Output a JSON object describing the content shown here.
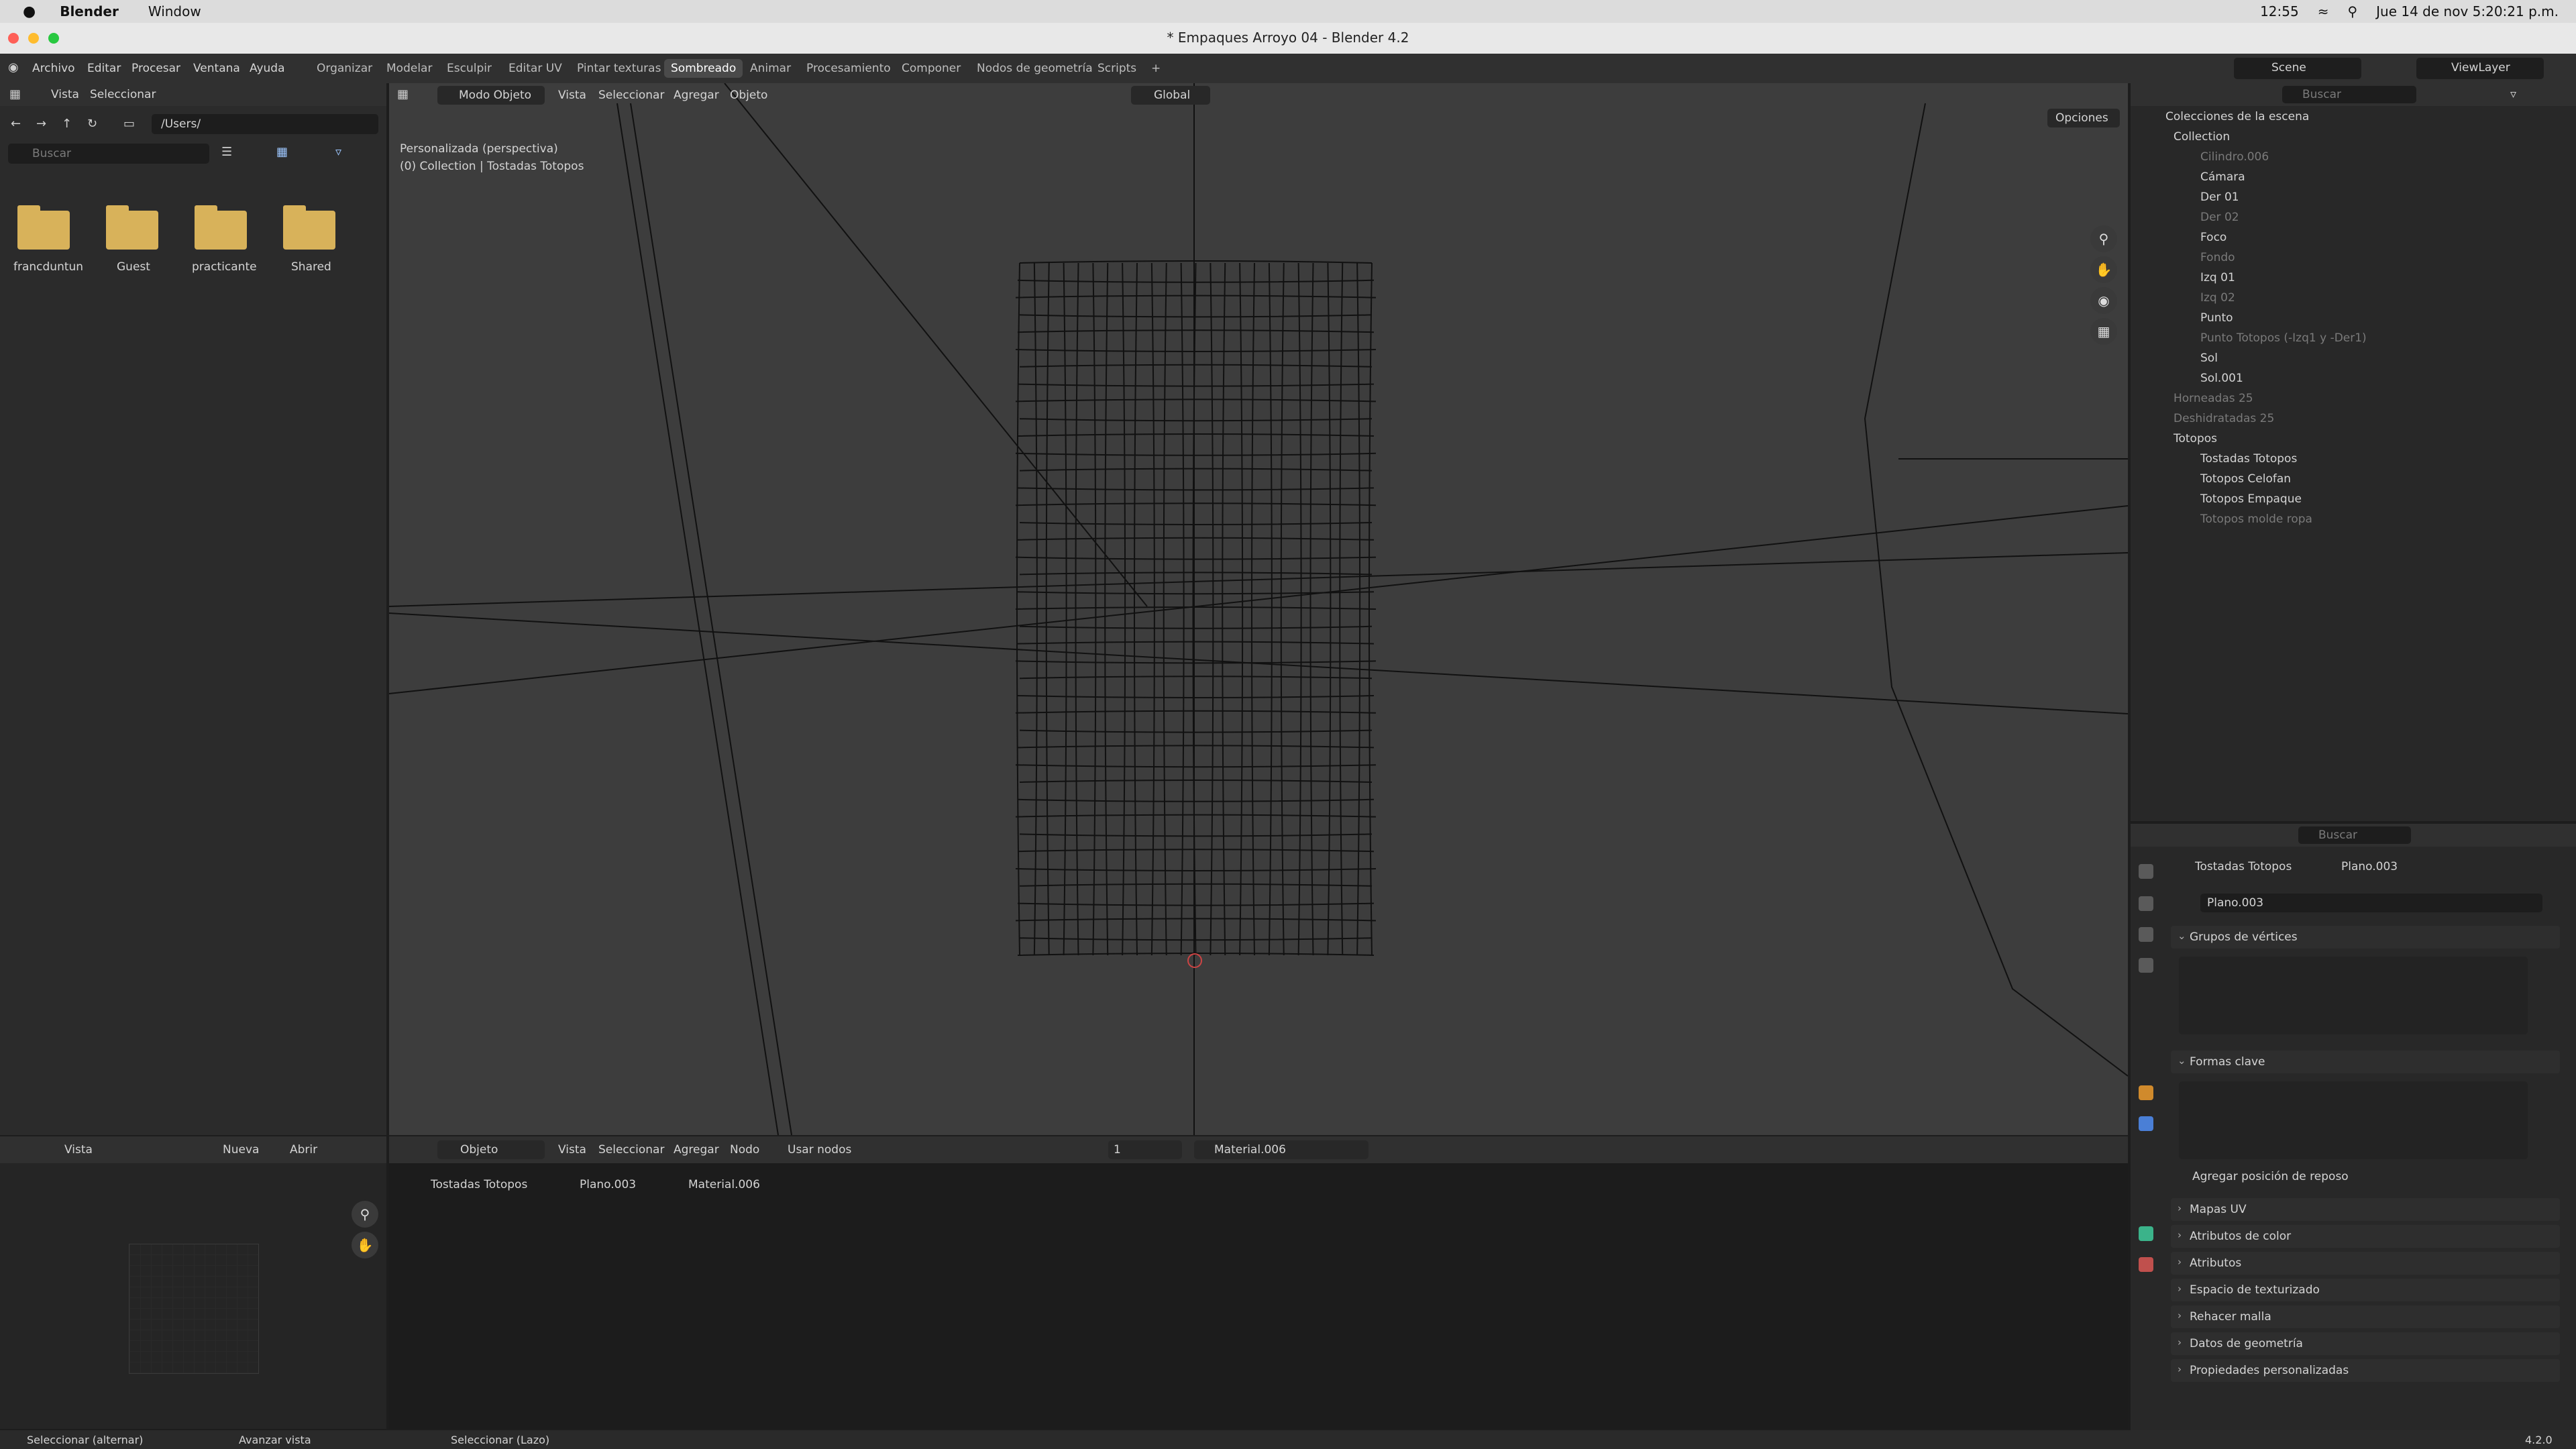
{
  "mac_menu": {
    "apple": "",
    "app": "Blender",
    "window": "Window",
    "time": "12:55",
    "date": "Jue 14 de nov  5:20:21 p.m."
  },
  "window": {
    "title": "* Empaques Arroyo 04 - Blender 4.2"
  },
  "topbar": {
    "menus": [
      "Archivo",
      "Editar",
      "Procesar",
      "Ventana",
      "Ayuda"
    ],
    "workspaces": [
      "Organizar",
      "Modelar",
      "Esculpir",
      "Editar UV",
      "Pintar texturas",
      "Sombreado",
      "Animar",
      "Procesamiento",
      "Componer",
      "Nodos de geometría",
      "Scripts"
    ],
    "active_workspace": "Sombreado",
    "scene": "Scene",
    "view_layer": "ViewLayer"
  },
  "file_browser": {
    "menus": [
      "Vista",
      "Seleccionar"
    ],
    "path": "/Users/",
    "search_placeholder": "Buscar",
    "items": [
      "francduntun",
      "Guest",
      "practicante",
      "Shared"
    ]
  },
  "viewport": {
    "mode": "Modo Objeto",
    "menus": [
      "Vista",
      "Seleccionar",
      "Agregar",
      "Objeto"
    ],
    "orientation": "Global",
    "options": "Opciones",
    "view_name": "Personalizada (perspectiva)",
    "collection_info": "(0) Collection | Tostadas Totopos"
  },
  "outliner": {
    "search_placeholder": "Buscar",
    "rows": [
      {
        "label": "Colecciones de la escena",
        "dim": false
      },
      {
        "label": "Collection",
        "dim": false
      },
      {
        "label": "Cilindro.006",
        "dim": true
      },
      {
        "label": "Cámara",
        "dim": false
      },
      {
        "label": "Der 01",
        "dim": false
      },
      {
        "label": "Der 02",
        "dim": true
      },
      {
        "label": "Foco",
        "dim": false
      },
      {
        "label": "Fondo",
        "dim": true
      },
      {
        "label": "Izq 01",
        "dim": false
      },
      {
        "label": "Izq 02",
        "dim": true
      },
      {
        "label": "Punto",
        "dim": false
      },
      {
        "label": "Punto Totopos (-Izq1 y -Der1)",
        "dim": true
      },
      {
        "label": "Sol",
        "dim": false
      },
      {
        "label": "Sol.001",
        "dim": false
      },
      {
        "label": "Horneadas 25",
        "dim": true
      },
      {
        "label": "Deshidratadas 25",
        "dim": true
      },
      {
        "label": "Totopos",
        "dim": false
      },
      {
        "label": "Tostadas Totopos",
        "dim": false
      },
      {
        "label": "Totopos Celofan",
        "dim": false
      },
      {
        "label": "Totopos Empaque",
        "dim": false
      },
      {
        "label": "Totopos molde ropa",
        "dim": true
      }
    ]
  },
  "properties": {
    "search_placeholder": "Buscar",
    "breadcrumb_object": "Tostadas Totopos",
    "breadcrumb_mesh": "Plano.003",
    "mesh_name": "Plano.003",
    "sections": [
      "Grupos de vértices",
      "Formas clave",
      "Mapas UV",
      "Atributos de color",
      "Atributos",
      "Espacio de texturizado",
      "Rehacer malla",
      "Datos de geometría",
      "Propiedades personalizadas"
    ],
    "rest_position": "Agregar posición de reposo"
  },
  "image_editor": {
    "view": "Vista",
    "new": "Nueva",
    "open": "Abrir"
  },
  "node_editor": {
    "object_mode": "Objeto",
    "menus": [
      "Vista",
      "Seleccionar",
      "Agregar",
      "Nodo"
    ],
    "use_nodes": "Usar nodos",
    "slot": "1",
    "material": "Material.006",
    "breadcrumb": [
      "Tostadas Totopos",
      "Plano.003",
      "Material.006"
    ]
  },
  "statusbar": {
    "left": "Seleccionar (alternar)",
    "mid": "Avanzar vista",
    "mid2": "Seleccionar (Lazo)",
    "version": "4.2.0"
  }
}
